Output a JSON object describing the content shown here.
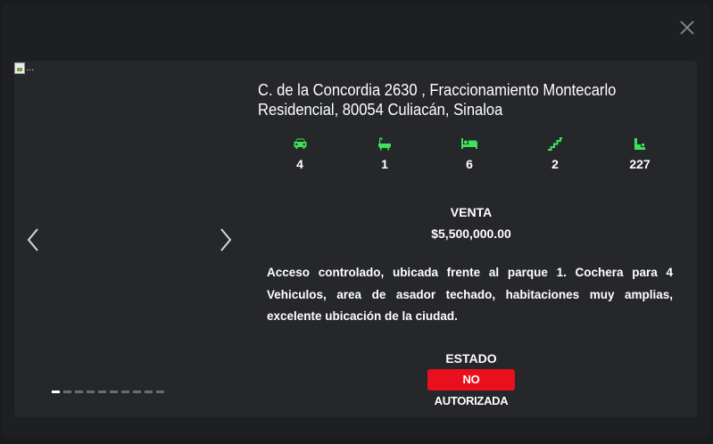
{
  "modal": {
    "close_icon": "close-icon"
  },
  "gallery": {
    "image_alt": "...",
    "prev_icon": "chevron-left-icon",
    "next_icon": "chevron-right-icon",
    "slide_count": 10,
    "active_slide": 1
  },
  "property": {
    "address_line1": "C. de la Concordia 2630 , Fraccionamiento Montecarlo",
    "address_line2": "Residencial, 80054 Culiacán, Sinaloa",
    "features": [
      {
        "icon": "car-icon",
        "value": "4"
      },
      {
        "icon": "bathtub-icon",
        "value": "1"
      },
      {
        "icon": "bed-icon",
        "value": "6"
      },
      {
        "icon": "stairs-icon",
        "value": "2"
      },
      {
        "icon": "area-icon",
        "value": "227"
      }
    ],
    "operation": "VENTA",
    "price": "$5,500,000.00",
    "description": "Acceso controlado, ubicada frente al parque 1. Cochera para 4 Vehiculos, area de asador techado, habitaciones muy amplias, excelente ubicación de la ciudad.",
    "status_label": "ESTADO",
    "status_value": "NO AUTORIZADA"
  },
  "colors": {
    "icon_accent": "#3be35a",
    "status_badge": "#e9101e",
    "card_bg": "#26272b",
    "modal_bg": "#1e1f22"
  }
}
